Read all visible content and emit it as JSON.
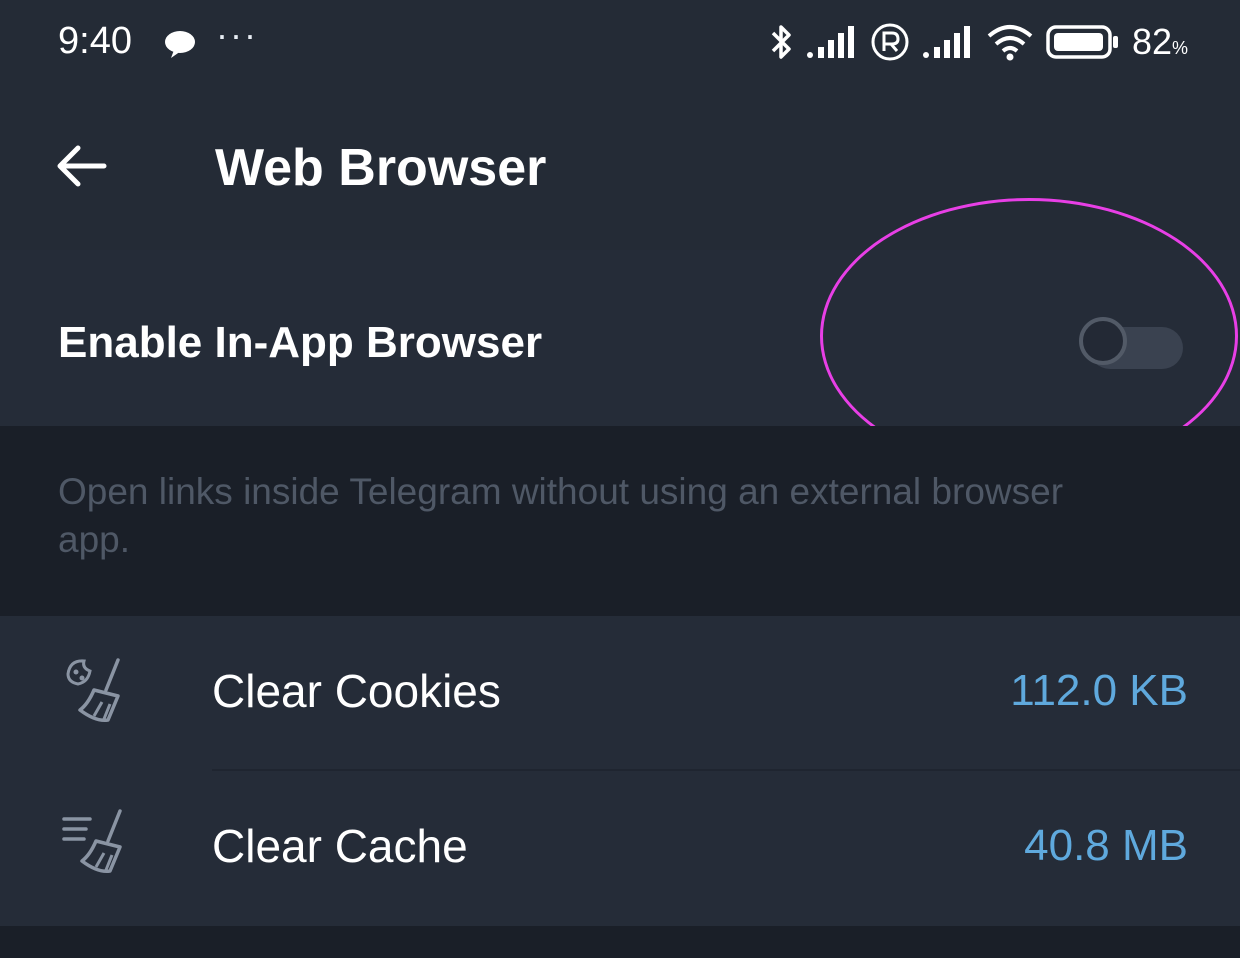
{
  "status_bar": {
    "time": "9:40",
    "more_indicator": "···",
    "battery_percent": "82",
    "battery_unit": "%",
    "icons": [
      "chat-notification-icon",
      "bluetooth-icon",
      "signal-icon",
      "roaming-icon",
      "wifi-icon",
      "battery-icon"
    ]
  },
  "app_bar": {
    "title": "Web Browser",
    "back_icon": "back-arrow-icon"
  },
  "settings": {
    "in_app_browser": {
      "label": "Enable In-App Browser",
      "enabled": false,
      "description": "Open links inside Telegram without using an external browser app."
    },
    "items": [
      {
        "label": "Clear Cookies",
        "value": "112.0 KB",
        "icon": "clear-cookies-icon"
      },
      {
        "label": "Clear Cache",
        "value": "40.8 MB",
        "icon": "clear-cache-icon"
      }
    ]
  },
  "colors": {
    "background": "#1f2531",
    "surface": "#252c38",
    "info_background": "#1a1f28",
    "accent_value": "#5fa9dd",
    "highlight_ring": "#e83fe6",
    "secondary_text": "#4f5866"
  }
}
